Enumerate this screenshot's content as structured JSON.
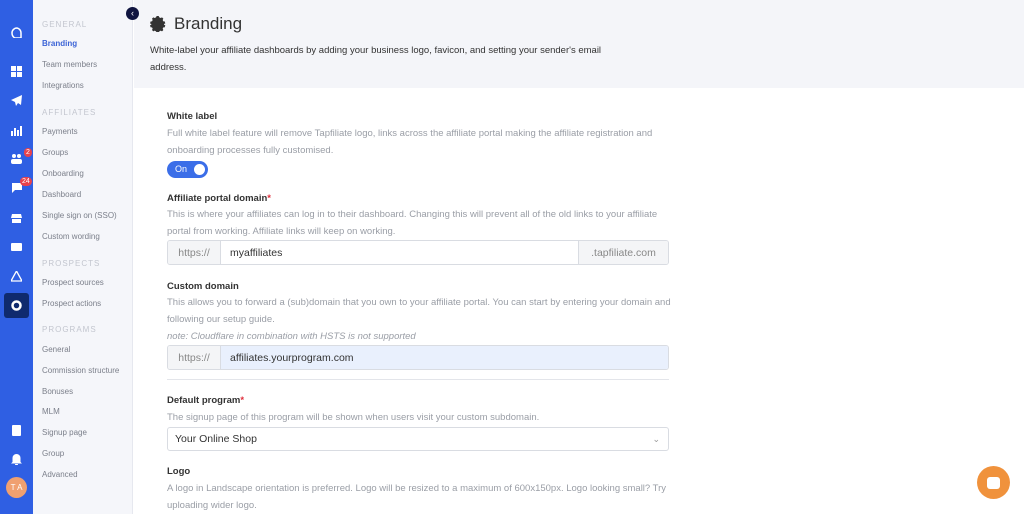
{
  "rail": {
    "icons": [
      "logo-icon",
      "dashboard-icon",
      "campaigns-icon",
      "reports-icon",
      "affiliates-icon",
      "conversations-icon",
      "store-icon",
      "wallet-icon",
      "prospects-icon",
      "settings-icon",
      "calculator-icon",
      "bell-icon"
    ],
    "badges": {
      "affiliates": "2",
      "conversations": "24"
    },
    "avatar": "T A",
    "accent": "#2f5fe3"
  },
  "sidebar": {
    "sections": [
      {
        "title": "GENERAL",
        "items": [
          "Branding",
          "Team members",
          "Integrations"
        ]
      },
      {
        "title": "AFFILIATES",
        "items": [
          "Payments",
          "Groups",
          "Onboarding",
          "Dashboard",
          "Single sign on (SSO)",
          "Custom wording"
        ]
      },
      {
        "title": "PROSPECTS",
        "items": [
          "Prospect sources",
          "Prospect actions"
        ]
      },
      {
        "title": "PROGRAMS",
        "items": [
          "General",
          "Commission structure",
          "Bonuses",
          "MLM",
          "Signup page",
          "Group",
          "Advanced"
        ]
      }
    ],
    "active": "Branding"
  },
  "header": {
    "title": "Branding",
    "subtitle": "White-label your affiliate dashboards by adding your business logo, favicon, and setting your sender's email address."
  },
  "form": {
    "white_label": {
      "label": "White label",
      "desc": "Full white label feature will remove Tapfiliate logo, links across the affiliate portal making the affiliate registration and onboarding processes fully customised.",
      "toggle": "On"
    },
    "portal_domain": {
      "label": "Affiliate portal domain",
      "required": "*",
      "desc": "This is where your affiliates can log in to their dashboard. Changing this will prevent all of the old links to your affiliate portal from working. Affiliate links will keep on working.",
      "prefix": "https://",
      "value": "myaffiliates",
      "suffix": ".tapfiliate.com"
    },
    "custom_domain": {
      "label": "Custom domain",
      "desc": "This allows you to forward a (sub)domain that you own to your affiliate portal. You can start by entering your domain and following our setup guide.",
      "note": "note: Cloudflare in combination with HSTS is not supported",
      "prefix": "https://",
      "value": "affiliates.yourprogram.com"
    },
    "default_program": {
      "label": "Default program",
      "required": "*",
      "desc": "The signup page of this program will be shown when users visit your custom subdomain.",
      "value": "Your Online Shop"
    },
    "logo": {
      "label": "Logo",
      "desc": "A logo in Landscape orientation is preferred. Logo will be resized to a maximum of 600x150px. Logo looking small? Try uploading wider logo."
    }
  }
}
